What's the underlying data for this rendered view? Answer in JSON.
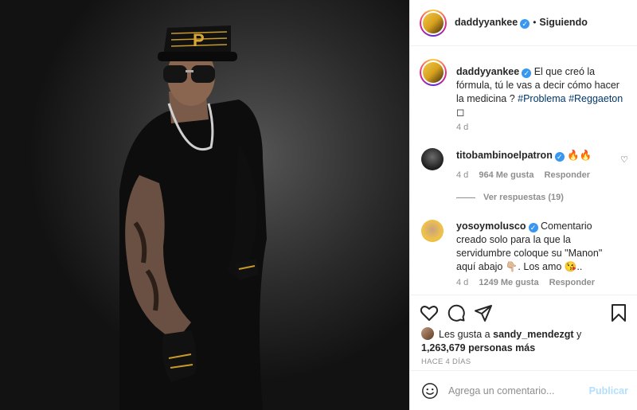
{
  "post": {
    "username": "daddyyankee",
    "follow_status": "Siguiendo",
    "separator": "•",
    "verified_glyph": "✓"
  },
  "caption": {
    "username": "daddyyankee",
    "text": "El que creó la fórmula, tú le vas a decir cómo hacer la medicina ?",
    "hashtags": [
      "#Problema",
      "#Reggaeton"
    ],
    "box_glyph": "◻",
    "time": "4 d"
  },
  "comments": [
    {
      "username": "titobambinoelpatron",
      "text": "🔥🔥",
      "time": "4 d",
      "likes": "964 Me gusta",
      "reply": "Responder",
      "view_replies": "Ver respuestas (19)"
    },
    {
      "username": "yosoymolusco",
      "text": "Comentario creado solo para la que la servidumbre coloque su \"Manon\" aquí abajo 👇🏼. Los amo 😘..",
      "time": "4 d",
      "likes": "1249 Me gusta",
      "reply": "Responder"
    }
  ],
  "likes": {
    "prefix": "Les gusta a",
    "user": "sandy_mendezgt",
    "connector": "y",
    "count": "1,263,679 personas más"
  },
  "timestamp": "HACE 4 DÍAS",
  "add_comment": {
    "placeholder": "Agrega un comentario...",
    "publish": "Publicar"
  },
  "icons": {
    "like": "heart-icon",
    "comment": "comment-icon",
    "share": "paper-plane-icon",
    "save": "bookmark-icon",
    "emoji": "smiley-icon"
  },
  "colors": {
    "verified": "#3897f0",
    "hashtag": "#00376b",
    "muted": "#8e8e8e",
    "publish_disabled": "#b2dffc"
  }
}
